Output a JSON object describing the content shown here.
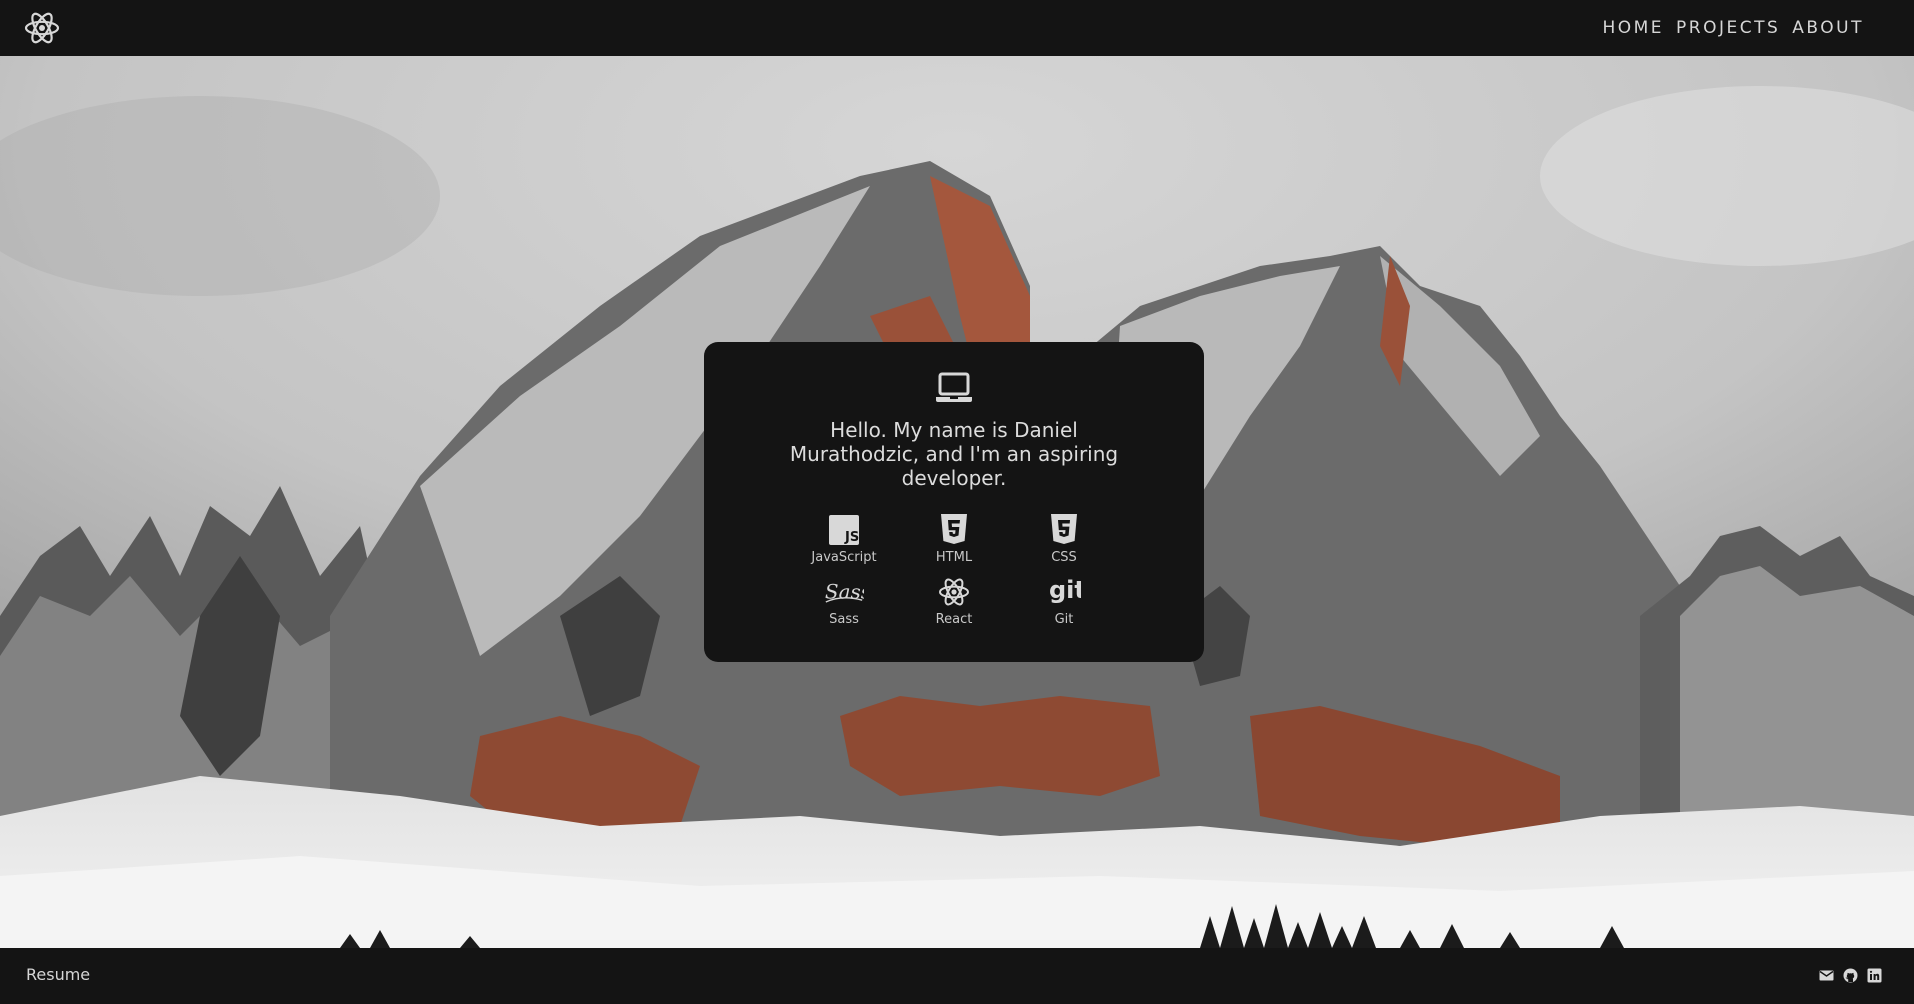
{
  "colors": {
    "bar_background": "#141414",
    "card_background": "#141414",
    "text": "#dcdcdc",
    "muted_text": "#c9c9c9"
  },
  "navbar": {
    "logo_icon": "react-atom-icon",
    "links": [
      {
        "label": "HOME"
      },
      {
        "label": "PROJECTS"
      },
      {
        "label": "ABOUT"
      }
    ]
  },
  "hero": {
    "background_image": "snowy-mountain-photo"
  },
  "card": {
    "icon": "laptop-icon",
    "intro": "Hello. My name is Daniel Murathodzic, and I'm an aspiring developer.",
    "skills": [
      {
        "label": "JavaScript",
        "icon": "javascript-icon"
      },
      {
        "label": "HTML",
        "icon": "html5-icon"
      },
      {
        "label": "CSS",
        "icon": "css3-icon"
      },
      {
        "label": "Sass",
        "icon": "sass-icon"
      },
      {
        "label": "React",
        "icon": "react-icon"
      },
      {
        "label": "Git",
        "icon": "git-icon"
      }
    ]
  },
  "footer": {
    "resume_label": "Resume",
    "social_icons": [
      "envelope-icon",
      "github-icon",
      "linkedin-icon"
    ]
  }
}
